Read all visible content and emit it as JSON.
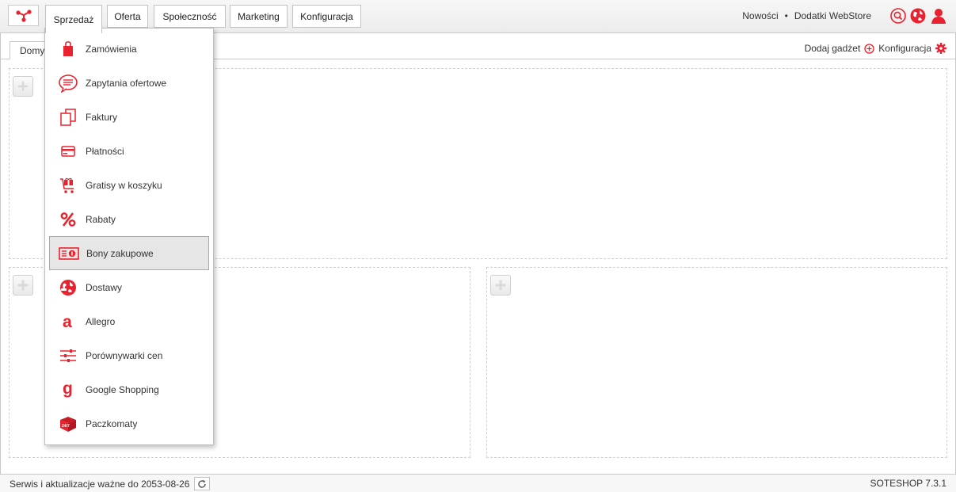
{
  "nav": {
    "tabs": [
      "Sprzedaż",
      "Oferta",
      "Społeczność",
      "Marketing",
      "Konfiguracja"
    ],
    "right_links": [
      "Nowości",
      "Dodatki WebStore"
    ],
    "separator": "•"
  },
  "subbar": {
    "tab_label": "Domy",
    "add_gadget": "Dodaj gadżet",
    "config": "Konfiguracja"
  },
  "sales_menu": {
    "items": [
      {
        "label": "Zamówienia",
        "icon": "shopping-bag-icon"
      },
      {
        "label": "Zapytania ofertowe",
        "icon": "chat-bubble-icon"
      },
      {
        "label": "Faktury",
        "icon": "documents-icon"
      },
      {
        "label": "Płatności",
        "icon": "credit-card-icon"
      },
      {
        "label": "Gratisy w koszyku",
        "icon": "gift-cart-icon"
      },
      {
        "label": "Rabaty",
        "icon": "percent-icon"
      },
      {
        "label": "Bony zakupowe",
        "icon": "voucher-icon"
      },
      {
        "label": "Dostawy",
        "icon": "globe-delivery-icon"
      },
      {
        "label": "Allegro",
        "icon": "allegro-icon"
      },
      {
        "label": "Porównywarki cen",
        "icon": "sliders-icon"
      },
      {
        "label": "Google Shopping",
        "icon": "google-icon"
      },
      {
        "label": "Paczkomaty",
        "icon": "parcel-locker-icon"
      }
    ],
    "hovered_index": 6
  },
  "footer": {
    "service_text": "Serwis i aktualizacje ważne do 2053-08-26",
    "version": "SOTESHOP 7.3.1"
  },
  "colors": {
    "accent": "#e8222e"
  }
}
